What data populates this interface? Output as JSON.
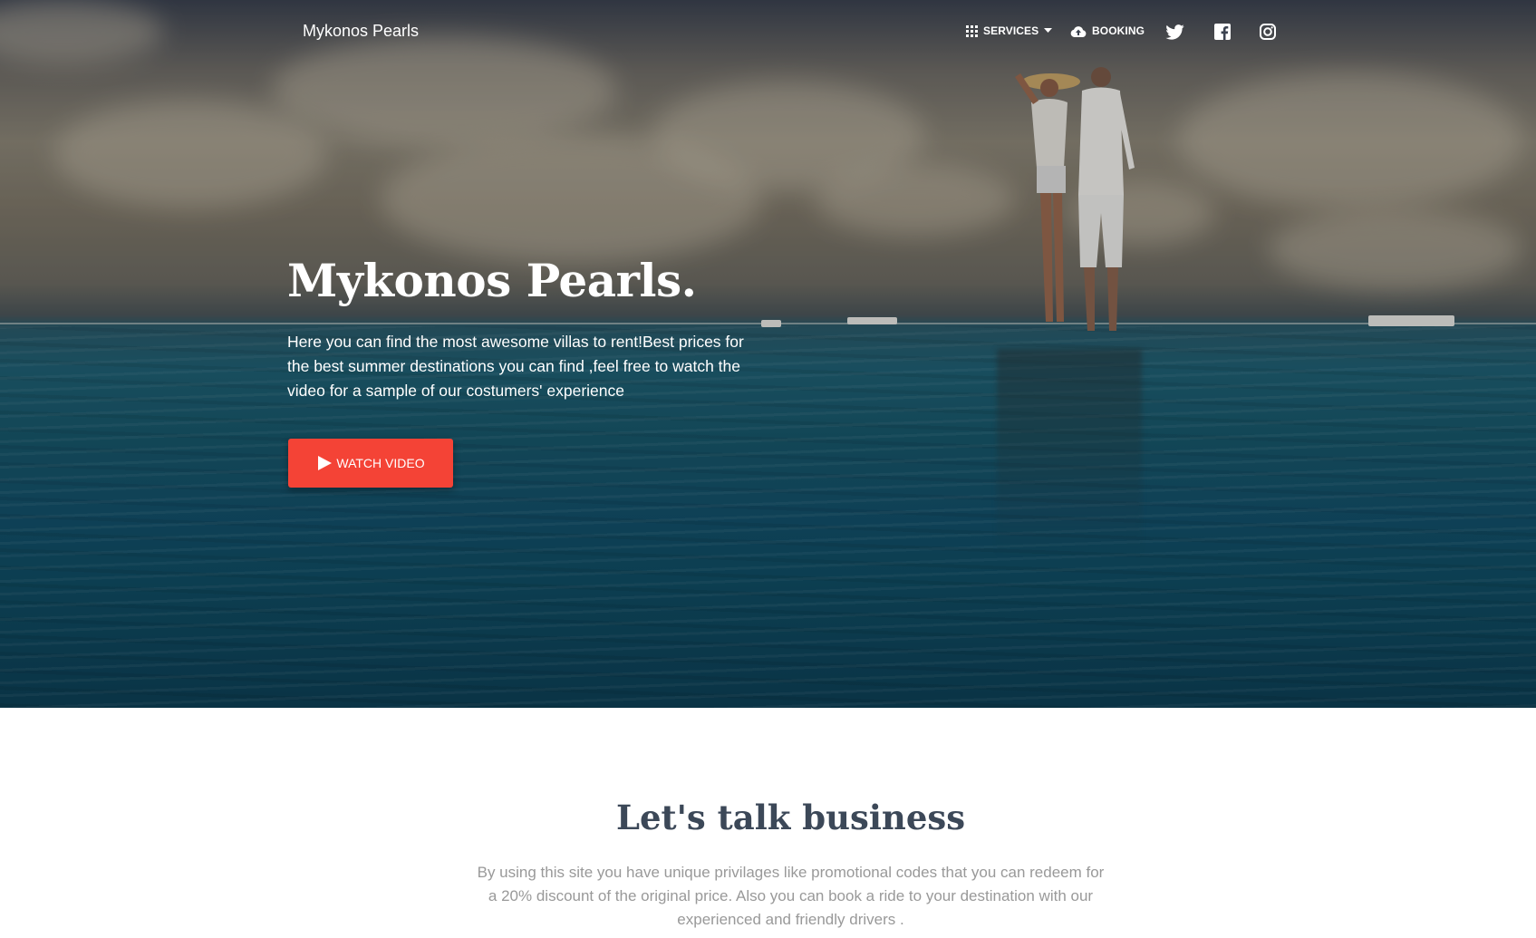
{
  "nav": {
    "brand": "Mykonos Pearls",
    "services_label": "Services",
    "booking_label": "Booking",
    "icons": [
      "apps-icon",
      "caret-down-icon",
      "cloud-upload-icon",
      "twitter-icon",
      "facebook-icon",
      "instagram-icon"
    ]
  },
  "hero": {
    "title": "Mykonos Pearls.",
    "description": "Here you can find the most awesome villas to rent!Best prices for the best summer destinations you can find ,feel free to watch the video for a sample of our costumers' experience",
    "button_label": "Watch video",
    "button_icon": "play-icon",
    "button_color": "#f44336"
  },
  "business": {
    "title": "Let's talk business",
    "text": "By using this site you have unique privilages like promotional codes that you can redeem for a 20% discount of the original price. Also you can book a ride to your destination with our experienced and friendly drivers ."
  },
  "colors": {
    "accent": "#f44336",
    "heading": "#3c4858",
    "muted_text": "#999999"
  }
}
